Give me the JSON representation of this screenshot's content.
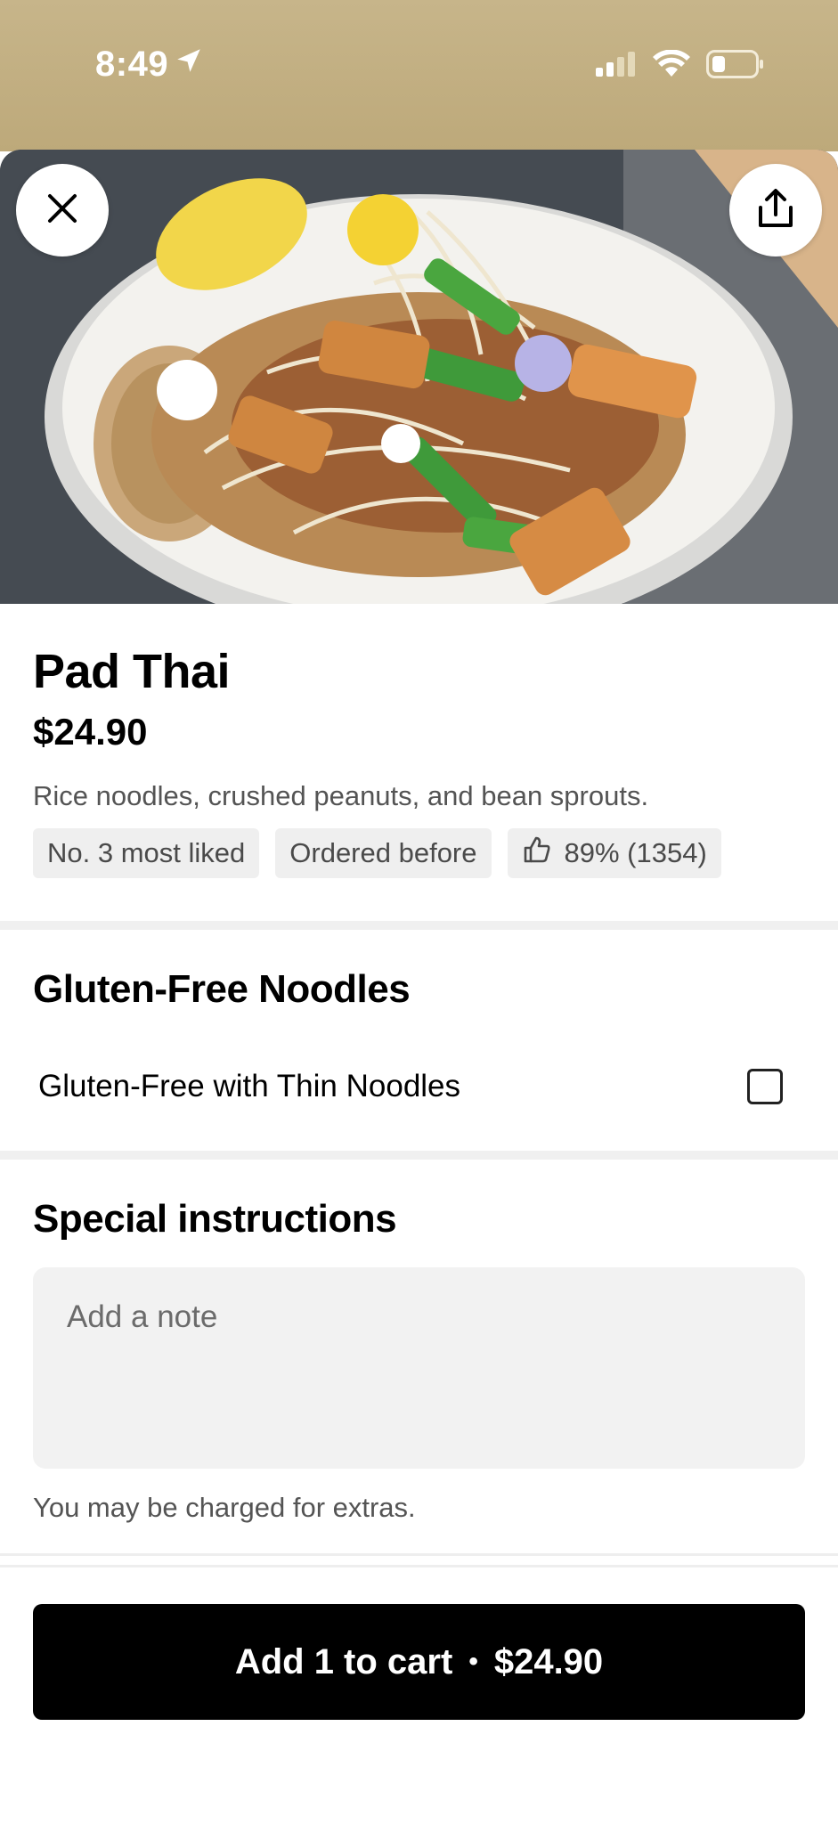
{
  "status_bar": {
    "time": "8:49",
    "location_icon": "location-arrow-icon",
    "signal_icon": "cellular-signal-icon",
    "wifi_icon": "wifi-icon",
    "battery_icon": "battery-low-icon"
  },
  "hero": {
    "image": "pad-thai-photo",
    "close_icon": "close-icon",
    "share_icon": "share-icon"
  },
  "item": {
    "title": "Pad Thai",
    "price": "$24.90",
    "description": "Rice noodles, crushed peanuts, and bean sprouts.",
    "badges": {
      "rank": "No. 3 most liked",
      "history": "Ordered before",
      "rating": "89% (1354)",
      "rating_icon": "thumbs-up-icon"
    }
  },
  "options": {
    "heading": "Gluten-Free Noodles",
    "choice_label": "Gluten-Free with Thin Noodles",
    "choice_checked": false
  },
  "instructions": {
    "heading": "Special instructions",
    "placeholder": "Add a note",
    "hint": "You may be charged for extras."
  },
  "cart": {
    "label": "Add 1 to cart",
    "separator": "•",
    "price": "$24.90"
  },
  "colors": {
    "status_bar": "#bfac7e",
    "chip_bg": "#efefef",
    "button_bg": "#000000",
    "note_bg": "#f2f2f2"
  }
}
